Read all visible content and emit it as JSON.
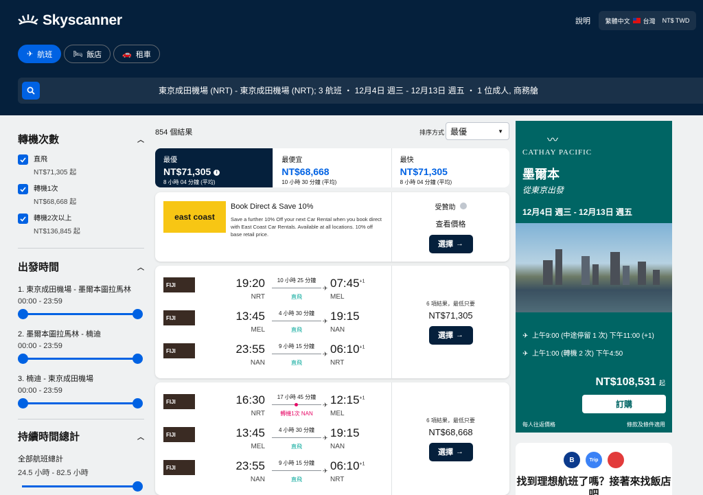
{
  "header": {
    "logo_text": "Skyscanner",
    "help": "說明",
    "locale": {
      "language": "繁體中文",
      "country": "台灣",
      "currency": "NT$ TWD"
    },
    "nav_tabs": [
      {
        "label": "航班",
        "icon": "plane-icon",
        "active": true
      },
      {
        "label": "飯店",
        "icon": "bed-icon",
        "active": false
      },
      {
        "label": "租車",
        "icon": "car-icon",
        "active": false
      }
    ],
    "search_summary": "東京成田機場 (NRT) - 東京成田機場 (NRT); 3 航班 ・ 12月4日 週三 - 12月13日 週五 ・ 1 位成人, 商務艙"
  },
  "filters": {
    "stops": {
      "title": "轉機次數",
      "items": [
        {
          "label": "直飛",
          "price": "NT$71,305 起",
          "checked": true
        },
        {
          "label": "轉機1次",
          "price": "NT$68,668 起",
          "checked": true
        },
        {
          "label": "轉機2次以上",
          "price": "NT$136,845 起",
          "checked": true
        }
      ]
    },
    "departure": {
      "title": "出發時間",
      "legs": [
        {
          "label": "1. 東京成田機場 - 墨爾本圖拉馬林",
          "range": "00:00 - 23:59"
        },
        {
          "label": "2. 墨爾本圖拉馬林 - 楠迪",
          "range": "00:00 - 23:59"
        },
        {
          "label": "3. 楠迪 - 東京成田機場",
          "range": "00:00 - 23:59"
        }
      ]
    },
    "duration": {
      "title": "持續時間總計",
      "label": "全部航班總計",
      "range": "24.5 小時 - 82.5 小時"
    }
  },
  "results": {
    "count": "854 個結果",
    "sort_label": "排序方式",
    "sort_value": "最優",
    "sort_tabs": [
      {
        "name": "最優",
        "price": "NT$71,305",
        "duration": "8 小時 04 分鐘 (平均)",
        "active": true
      },
      {
        "name": "最便宜",
        "price": "NT$68,668",
        "duration": "10 小時 30 分鐘 (平均)",
        "active": false
      },
      {
        "name": "最快",
        "price": "NT$71,305",
        "duration": "8 小時 04 分鐘 (平均)",
        "active": false
      }
    ],
    "ad": {
      "logo": "east coast",
      "title": "Book Direct & Save 10%",
      "desc": "Save a further 10% Off your next Car Rental when you book direct with East Coast Car Rentals. Available at all locations. 10% off base retail price.",
      "sponsored": "受贊助",
      "check_price": "查看價格",
      "select": "選擇"
    },
    "itineraries": [
      {
        "legs": [
          {
            "airline": "FIJI",
            "dep": "19:20",
            "dep_code": "NRT",
            "arr": "07:45",
            "arr_plus": "+1",
            "arr_code": "MEL",
            "duration": "10 小時 25 分鐘",
            "stops": "直飛",
            "stop_red": false
          },
          {
            "airline": "FIJI",
            "dep": "13:45",
            "dep_code": "MEL",
            "arr": "19:15",
            "arr_plus": "",
            "arr_code": "NAN",
            "duration": "4 小時 30 分鐘",
            "stops": "直飛",
            "stop_red": false
          },
          {
            "airline": "FIJI",
            "dep": "23:55",
            "dep_code": "NAN",
            "arr": "06:10",
            "arr_plus": "+1",
            "arr_code": "NRT",
            "duration": "9 小時 15 分鐘",
            "stops": "直飛",
            "stop_red": false
          }
        ],
        "deals": "6 項結果，最低只要",
        "price": "NT$71,305",
        "select": "選擇"
      },
      {
        "legs": [
          {
            "airline": "FIJI",
            "dep": "16:30",
            "dep_code": "NRT",
            "arr": "12:15",
            "arr_plus": "+1",
            "arr_code": "MEL",
            "duration": "17 小時 45 分鐘",
            "stops": "轉機1次 NAN",
            "stop_red": true
          },
          {
            "airline": "FIJI",
            "dep": "13:45",
            "dep_code": "MEL",
            "arr": "19:15",
            "arr_plus": "",
            "arr_code": "NAN",
            "duration": "4 小時 30 分鐘",
            "stops": "直飛",
            "stop_red": false
          },
          {
            "airline": "FIJI",
            "dep": "23:55",
            "dep_code": "NAN",
            "arr": "06:10",
            "arr_plus": "+1",
            "arr_code": "NRT",
            "duration": "9 小時 15 分鐘",
            "stops": "直飛",
            "stop_red": false
          }
        ],
        "deals": "6 項結果，最低只要",
        "price": "NT$68,668",
        "select": "選擇"
      }
    ]
  },
  "cathay_ad": {
    "logo": "CATHAY PACIFIC",
    "dest": "墨爾本",
    "from": "從東京出發",
    "dates": "12月4日 週三 - 12月13日 週五",
    "out_flight": "上午9:00 (中途停留 1 次) 下午11:00 (+1)",
    "ret_flight": "上午1:00 (轉機 2 次) 下午4:50",
    "price": "NT$108,531",
    "price_suffix": "起",
    "book": "訂購",
    "foot_left": "每人往返價格",
    "foot_right": "條款及條件適用"
  },
  "hotel_promo": {
    "icons": [
      "B",
      "Trip",
      "agoda"
    ],
    "text": "找到理想航班了嗎？接著來找飯店吧"
  },
  "colors": {
    "header_bg": "#05203c",
    "accent": "#0062e3",
    "cathay": "#006564",
    "stop_red": "#e70866",
    "direct_green": "#00a698"
  }
}
